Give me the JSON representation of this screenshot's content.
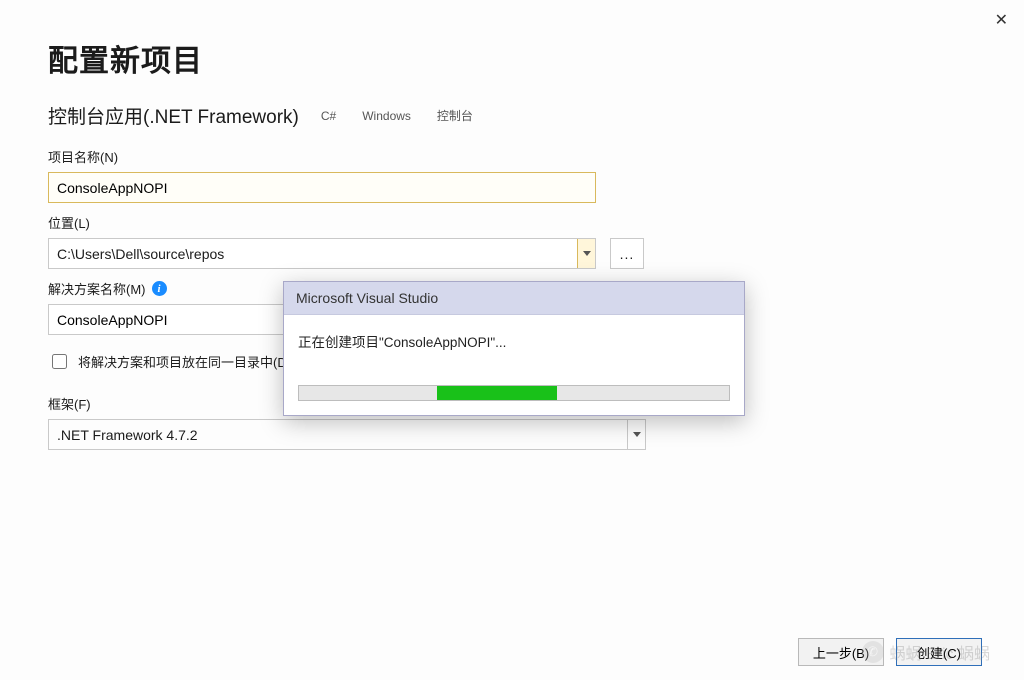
{
  "close_glyph": "✕",
  "header": {
    "title": "配置新项目"
  },
  "project_type": {
    "title": "控制台应用(.NET Framework)",
    "tags": [
      "C#",
      "Windows",
      "控制台"
    ]
  },
  "fields": {
    "project_name": {
      "label": "项目名称(N)",
      "value": "ConsoleAppNOPI"
    },
    "location": {
      "label": "位置(L)",
      "value": "C:\\Users\\Dell\\source\\repos",
      "browse_glyph": "..."
    },
    "solution_name": {
      "label": "解决方案名称(M)",
      "value": "ConsoleAppNOPI"
    },
    "same_dir_checkbox": {
      "label": "将解决方案和项目放在同一目录中(D)",
      "checked": false
    },
    "framework": {
      "label": "框架(F)",
      "value": ".NET Framework 4.7.2"
    }
  },
  "progress_dialog": {
    "title": "Microsoft Visual Studio",
    "message": "正在创建项目\"ConsoleAppNOPI\"..."
  },
  "buttons": {
    "back": "上一步(B)",
    "create": "创建(C)"
  },
  "watermark": {
    "text": "蜗蜗 Eric 蜗蜗"
  }
}
